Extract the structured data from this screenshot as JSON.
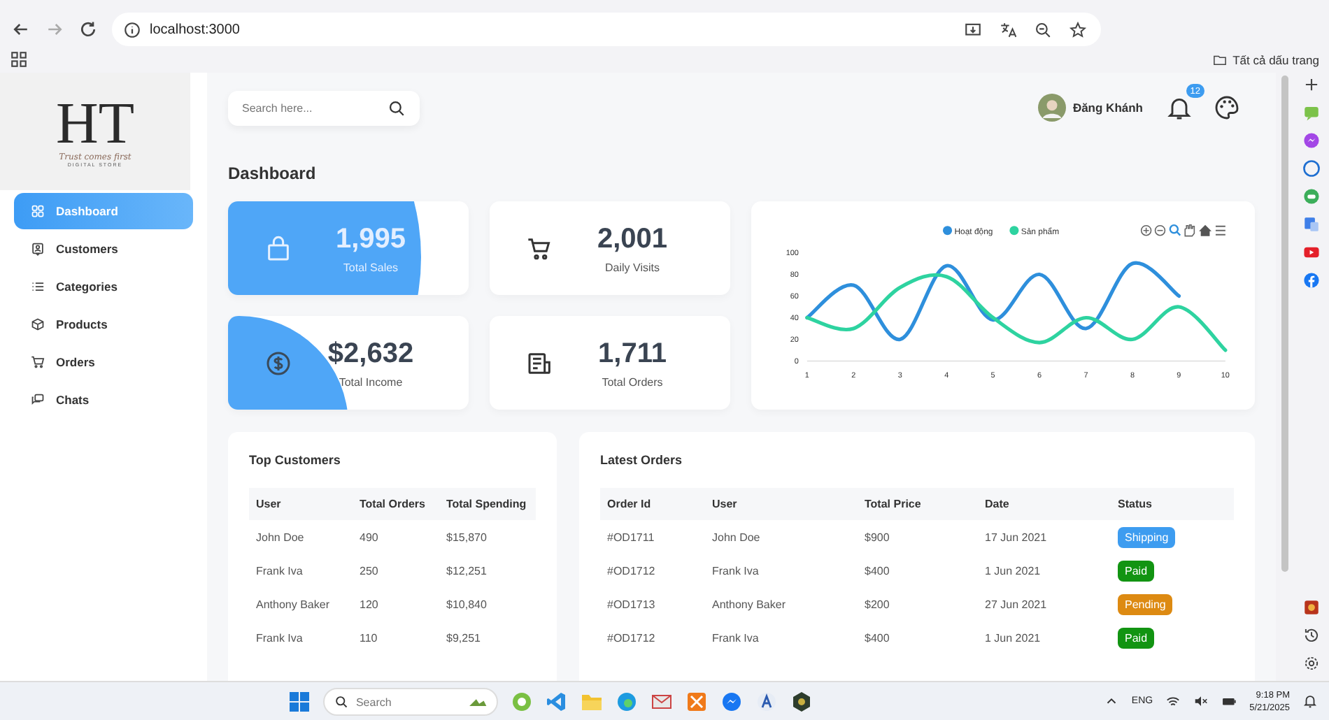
{
  "browser": {
    "address": "localhost:3000",
    "bookmarks_label": "Tất cả dấu trang"
  },
  "logo": {
    "monogram": "HT",
    "tagline": "Trust comes first",
    "subtitle": "DIGITAL STORE"
  },
  "sidebar": {
    "items": [
      {
        "label": "Dashboard",
        "selected": true
      },
      {
        "label": "Customers",
        "selected": false
      },
      {
        "label": "Categories",
        "selected": false
      },
      {
        "label": "Products",
        "selected": false
      },
      {
        "label": "Orders",
        "selected": false
      },
      {
        "label": "Chats",
        "selected": false
      }
    ]
  },
  "search": {
    "placeholder": "Search here..."
  },
  "user": {
    "name": "Đăng Khánh",
    "notifications": "12"
  },
  "page_title": "Dashboard",
  "stats": [
    {
      "value": "1,995",
      "label": "Total Sales",
      "highlighted": true
    },
    {
      "value": "2,001",
      "label": "Daily Visits",
      "highlighted": false
    },
    {
      "value": "$2,632",
      "label": "Total Income",
      "highlighted": true
    },
    {
      "value": "1,711",
      "label": "Total Orders",
      "highlighted": false
    }
  ],
  "chart": {
    "chart_data": {
      "type": "line",
      "legend": "top",
      "x": [
        1,
        2,
        3,
        4,
        5,
        6,
        7,
        8,
        9,
        10
      ],
      "xlim": [
        1,
        10
      ],
      "ylim": [
        0,
        100
      ],
      "yticks": [
        0,
        20,
        40,
        60,
        80,
        100
      ],
      "xticks": [
        1,
        2,
        3,
        4,
        5,
        6,
        7,
        8,
        9,
        10
      ],
      "series": [
        {
          "name": "Hoạt động",
          "color": "#2e8fdc",
          "values": [
            40,
            70,
            20,
            88,
            38,
            80,
            30,
            90,
            60,
            null
          ]
        },
        {
          "name": "Sản phẩm",
          "color": "#2ed3a0",
          "values": [
            40,
            30,
            68,
            78,
            40,
            17,
            40,
            20,
            50,
            10
          ]
        }
      ]
    }
  },
  "top_customers": {
    "title": "Top Customers",
    "columns": [
      "User",
      "Total Orders",
      "Total Spending"
    ],
    "rows": [
      [
        "John Doe",
        "490",
        "$15,870"
      ],
      [
        "Frank Iva",
        "250",
        "$12,251"
      ],
      [
        "Anthony Baker",
        "120",
        "$10,840"
      ],
      [
        "Frank Iva",
        "110",
        "$9,251"
      ]
    ]
  },
  "latest_orders": {
    "title": "Latest Orders",
    "columns": [
      "Order Id",
      "User",
      "Total Price",
      "Date",
      "Status"
    ],
    "rows": [
      {
        "order_id": "#OD1711",
        "user": "John Doe",
        "price": "$900",
        "date": "17 Jun 2021",
        "status": "Shipping",
        "color": "#3d9cf0"
      },
      {
        "order_id": "#OD1712",
        "user": "Frank Iva",
        "price": "$400",
        "date": "1 Jun 2021",
        "status": "Paid",
        "color": "#129412"
      },
      {
        "order_id": "#OD1713",
        "user": "Anthony Baker",
        "price": "$200",
        "date": "27 Jun 2021",
        "status": "Pending",
        "color": "#dd8a12"
      },
      {
        "order_id": "#OD1712",
        "user": "Frank Iva",
        "price": "$400",
        "date": "1 Jun 2021",
        "status": "Paid",
        "color": "#129412"
      }
    ]
  },
  "taskbar": {
    "search_placeholder": "Search",
    "language": "ENG",
    "time": "9:18 PM",
    "date": "5/21/2025"
  }
}
